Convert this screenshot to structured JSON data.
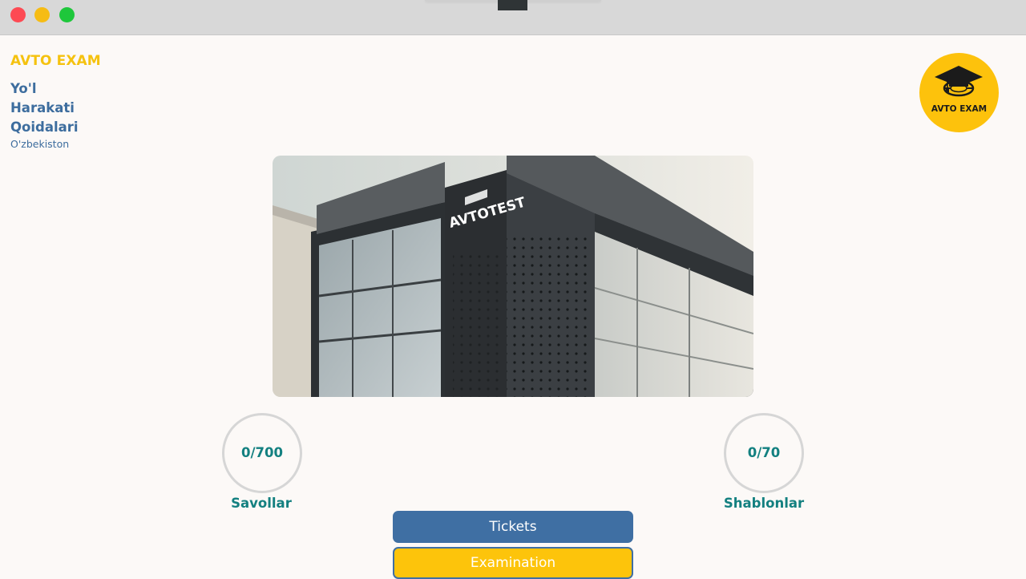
{
  "window": {
    "controls": [
      "close",
      "minimize",
      "maximize"
    ]
  },
  "sidebar": {
    "brand": "AVTO EXAM",
    "subtitle_lines": [
      "Yo'l",
      "Harakati",
      "Qoidalari"
    ],
    "country": "O'zbekiston"
  },
  "logo": {
    "icon": "graduation-cap-steering-wheel-icon",
    "text": "AVTO EXAM",
    "color": "#fdc20c"
  },
  "hero": {
    "sign_text": "AVTOTEST"
  },
  "stats": {
    "questions": {
      "value": "0/700",
      "label": "Savollar"
    },
    "templates": {
      "value": "0/70",
      "label": "Shablonlar"
    }
  },
  "buttons": {
    "tickets": "Tickets",
    "examination": "Examination"
  },
  "colors": {
    "brand_yellow": "#f5c20f",
    "primary_blue": "#3f6fa3",
    "stat_teal": "#138080"
  }
}
